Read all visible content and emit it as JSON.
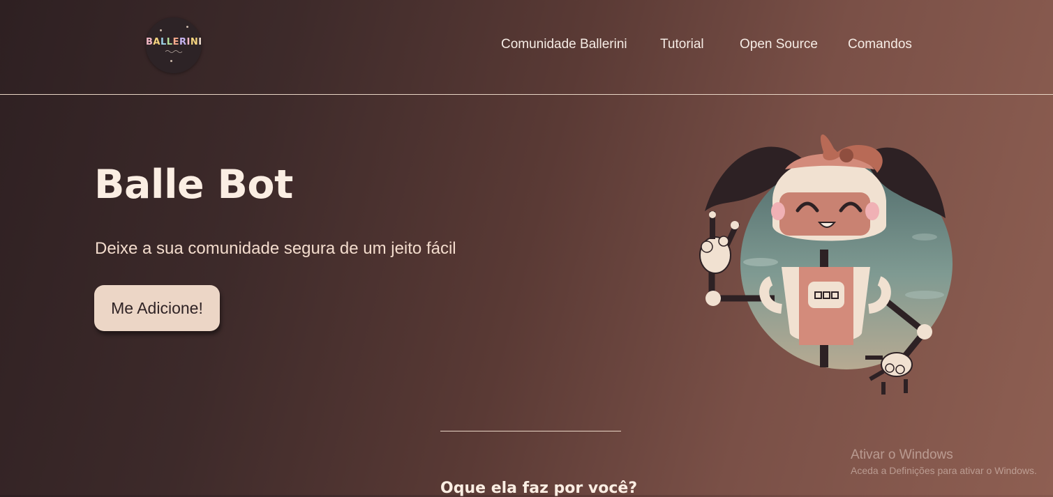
{
  "header": {
    "logo": {
      "text_letters": [
        "B",
        "A",
        "L",
        "L",
        "E",
        "R",
        "I",
        "N",
        "I"
      ]
    },
    "nav": [
      "Comunidade Ballerini",
      "Tutorial",
      "Open Source",
      "Comandos"
    ]
  },
  "hero": {
    "title": "Balle Bot",
    "subtitle": "Deixe a sua comunidade segura de um jeito fácil",
    "cta_label": "Me Adicione!",
    "illustration_icon": "robot-girl-illustration"
  },
  "section": {
    "title": "Oque ela faz por você?"
  },
  "windows_watermark": {
    "title": "Ativar o Windows",
    "subtitle": "Aceda a Definições para ativar o Windows."
  },
  "colors": {
    "background_dark": "#2e2022",
    "background_light": "#8e5f52",
    "text_light": "#fbeee3",
    "button_bg": "#ecd6c6",
    "button_text": "#2f2325"
  }
}
